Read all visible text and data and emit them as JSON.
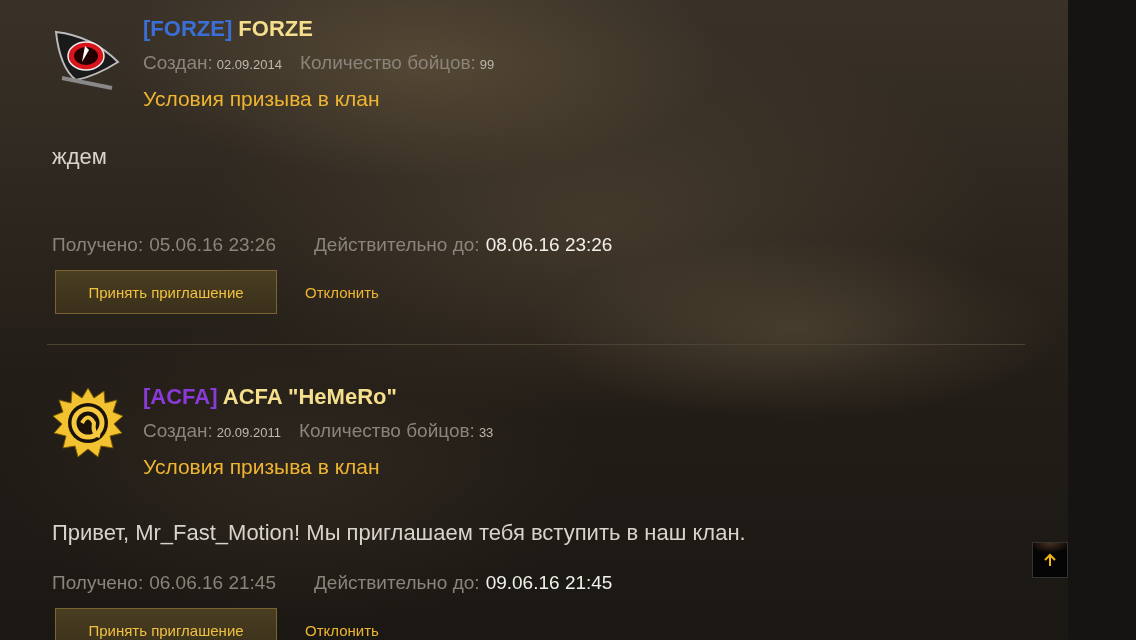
{
  "invites": [
    {
      "tag": "[FORZE]",
      "color": "#3a6fd8",
      "name": "FORZE",
      "created_label": "Создан:",
      "created": "02.09.2014",
      "members_label": "Количество бойцов:",
      "members": "99",
      "terms_link": "Условия призыва в клан",
      "message": "ждем",
      "received_label": "Получено:",
      "received": "05.06.16 23:26",
      "valid_label": "Действительно до:",
      "valid": "08.06.16 23:26",
      "accept": "Принять приглашение",
      "decline": "Отклонить"
    },
    {
      "tag": "[ACFA]",
      "color": "#8a3ad8",
      "name": "ACFA \"HeMeRo\"",
      "created_label": "Создан:",
      "created": "20.09.2011",
      "members_label": "Количество бойцов:",
      "members": "33",
      "terms_link": "Условия призыва в клан",
      "message": "Привет, Mr_Fast_Motion! Мы приглашаем тебя вступить в наш клан.",
      "received_label": "Получено:",
      "received": "06.06.16 21:45",
      "valid_label": "Действительно до:",
      "valid": "09.06.16 21:45",
      "accept": "Принять приглашение",
      "decline": "Отклонить"
    }
  ]
}
